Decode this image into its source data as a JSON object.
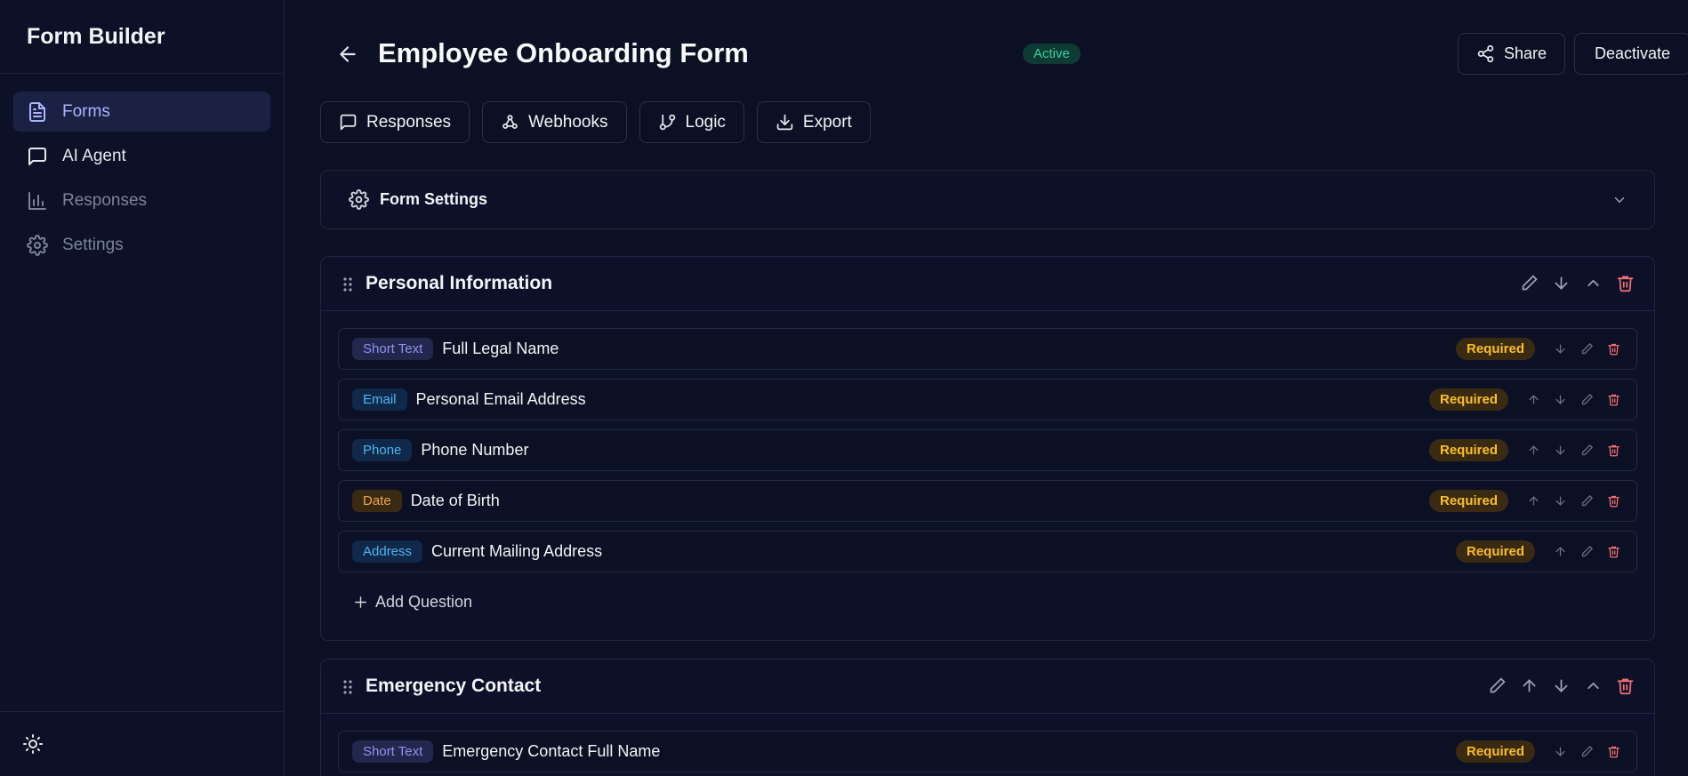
{
  "app": {
    "title": "Form Builder"
  },
  "sidebar": {
    "items": [
      {
        "label": "Forms",
        "icon": "document-icon"
      },
      {
        "label": "AI Agent",
        "icon": "chat-icon"
      },
      {
        "label": "Responses",
        "icon": "bar-chart-icon"
      },
      {
        "label": "Settings",
        "icon": "gear-icon"
      }
    ],
    "footer_icon": "sun-icon"
  },
  "header": {
    "title": "Employee Onboarding Form",
    "status": "Active",
    "share_label": "Share",
    "deactivate_label": "Deactivate"
  },
  "toolbar": {
    "responses": "Responses",
    "webhooks": "Webhooks",
    "logic": "Logic",
    "export": "Export"
  },
  "settings": {
    "label": "Form Settings"
  },
  "sections": [
    {
      "title": "Personal Information",
      "questions": [
        {
          "type": "Short Text",
          "label": "Full Legal Name",
          "required": "Required"
        },
        {
          "type": "Email",
          "label": "Personal Email Address",
          "required": "Required"
        },
        {
          "type": "Phone",
          "label": "Phone Number",
          "required": "Required"
        },
        {
          "type": "Date",
          "label": "Date of Birth",
          "required": "Required"
        },
        {
          "type": "Address",
          "label": "Current Mailing Address",
          "required": "Required"
        }
      ],
      "add_label": "Add Question"
    },
    {
      "title": "Emergency Contact",
      "questions": [
        {
          "type": "Short Text",
          "label": "Emergency Contact Full Name",
          "required": "Required"
        }
      ]
    }
  ],
  "colors": {
    "accent": "#aab4ff",
    "active_status": "#34d399",
    "required": "#fbbf24",
    "delete": "#f87171"
  }
}
